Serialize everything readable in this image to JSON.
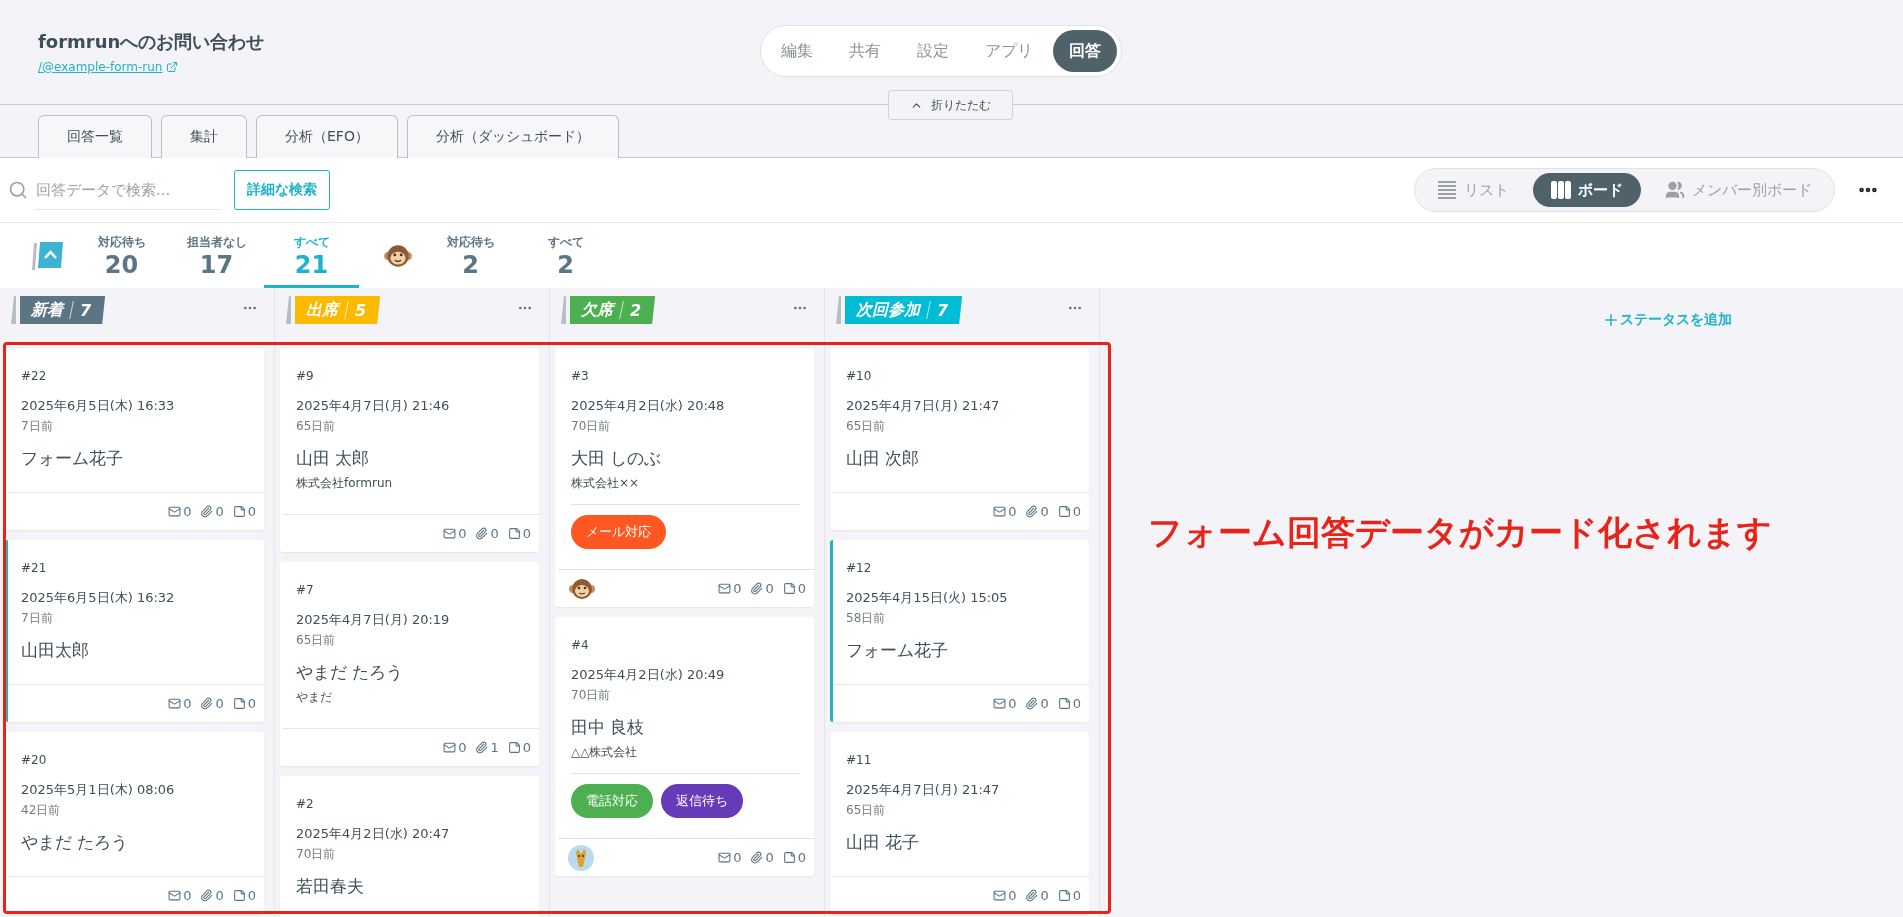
{
  "form": {
    "title": "formrunへのお問い合わせ",
    "link": "/@example-form-run"
  },
  "nav": [
    {
      "label": "編集",
      "selected": false
    },
    {
      "label": "共有",
      "selected": false
    },
    {
      "label": "設定",
      "selected": false
    },
    {
      "label": "アプリ",
      "selected": false
    },
    {
      "label": "回答",
      "selected": true
    }
  ],
  "collapse_button": "折りたたむ",
  "tabs": [
    "回答一覧",
    "集計",
    "分析（EFO）",
    "分析（ダッシュボード）"
  ],
  "search": {
    "placeholder": "回答データで検索...",
    "advanced_button": "詳細な検索"
  },
  "views": [
    {
      "label": "リスト",
      "kind": "list",
      "selected": false
    },
    {
      "label": "ボード",
      "kind": "board",
      "selected": true
    },
    {
      "label": "メンバー別ボード",
      "kind": "members",
      "selected": false
    }
  ],
  "count_groups": [
    {
      "kind": "status",
      "items": [
        {
          "label": "対応待ち",
          "count": "20",
          "selected": false
        },
        {
          "label": "担当者なし",
          "count": "17",
          "selected": false
        },
        {
          "label": "すべて",
          "count": "21",
          "selected": true
        }
      ]
    },
    {
      "kind": "monkey",
      "items": [
        {
          "label": "対応待ち",
          "count": "2",
          "selected": false
        },
        {
          "label": "すべて",
          "count": "2",
          "selected": false
        }
      ]
    }
  ],
  "columns": [
    {
      "status": "新着",
      "count": "7",
      "color": "#5b7584",
      "cards": [
        {
          "number": "#22",
          "date": "2025年6月5日(木) 16:33",
          "ago": "7日前",
          "name": "フォーム花子",
          "mail": "0",
          "attachments": "0",
          "notes": "0",
          "selected": false
        },
        {
          "number": "#21",
          "date": "2025年6月5日(木) 16:32",
          "ago": "7日前",
          "name": "山田太郎",
          "mail": "0",
          "attachments": "0",
          "notes": "0",
          "selected": true
        },
        {
          "number": "#20",
          "date": "2025年5月1日(木) 08:06",
          "ago": "42日前",
          "name": "やまだ たろう",
          "mail": "0",
          "attachments": "0",
          "notes": "0",
          "selected": false
        }
      ]
    },
    {
      "status": "出席",
      "count": "5",
      "color": "#fbb900",
      "cards": [
        {
          "number": "#9",
          "date": "2025年4月7日(月) 21:46",
          "ago": "65日前",
          "name": "山田 太郎",
          "company": "株式会社formrun",
          "mail": "0",
          "attachments": "0",
          "notes": "0",
          "selected": false
        },
        {
          "number": "#7",
          "date": "2025年4月7日(月) 20:19",
          "ago": "65日前",
          "name": "やまだ たろう",
          "company": "やまだ",
          "mail": "0",
          "attachments": "1",
          "notes": "0",
          "selected": false
        },
        {
          "number": "#2",
          "date": "2025年4月2日(水) 20:47",
          "ago": "70日前",
          "name": "若田春夫",
          "selected": false
        }
      ]
    },
    {
      "status": "欠席",
      "count": "2",
      "color": "#4caf50",
      "cards": [
        {
          "number": "#3",
          "date": "2025年4月2日(水) 20:48",
          "ago": "70日前",
          "name": "大田 しのぶ",
          "company": "株式会社××",
          "tags": [
            {
              "label": "メール対応",
              "color": "#ff5722"
            }
          ],
          "assignee": {
            "kind": "monkey"
          },
          "mail": "0",
          "attachments": "0",
          "notes": "0",
          "selected": false
        },
        {
          "number": "#4",
          "date": "2025年4月2日(水) 20:49",
          "ago": "70日前",
          "name": "田中 良枝",
          "company": "△△株式会社",
          "tags": [
            {
              "label": "電話対応",
              "color": "#4caf50"
            },
            {
              "label": "返信待ち",
              "color": "#673ab7"
            }
          ],
          "assignee": {
            "kind": "giraffe"
          },
          "mail": "0",
          "attachments": "0",
          "notes": "0",
          "selected": false
        }
      ]
    },
    {
      "status": "次回参加",
      "count": "7",
      "color": "#00bcd4",
      "cards": [
        {
          "number": "#10",
          "date": "2025年4月7日(月) 21:47",
          "ago": "65日前",
          "name": "山田 次郎",
          "mail": "0",
          "attachments": "0",
          "notes": "0",
          "selected": false
        },
        {
          "number": "#12",
          "date": "2025年4月15日(火) 15:05",
          "ago": "58日前",
          "name": "フォーム花子",
          "mail": "0",
          "attachments": "0",
          "notes": "0",
          "selected": true
        },
        {
          "number": "#11",
          "date": "2025年4月7日(月) 21:47",
          "ago": "65日前",
          "name": "山田 花子",
          "mail": "0",
          "attachments": "0",
          "notes": "0",
          "selected": false
        }
      ]
    }
  ],
  "add_status": "ステータスを追加",
  "annotation": "フォーム回答データがカード化されます"
}
